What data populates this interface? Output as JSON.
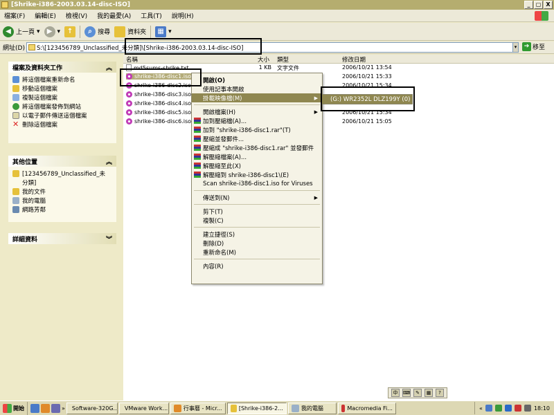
{
  "window": {
    "title": "[Shrike-i386-2003.03.14-disc-ISO]",
    "buttons": [
      "_",
      "▢",
      "X"
    ]
  },
  "menubar": {
    "items": [
      "檔案(F)",
      "編輯(E)",
      "檢視(V)",
      "我的最愛(A)",
      "工具(T)",
      "說明(H)"
    ]
  },
  "toolbar": {
    "back": "上一頁",
    "search": "搜尋",
    "folders": "資料夾"
  },
  "address": {
    "label": "網址(D)",
    "value": "S:\\[123456789_Unclassified_未分類]\\[Shrike-i386-2003.03.14-disc-ISO]",
    "go": "移至"
  },
  "left": {
    "tasks_title": "檔案及資料夾工作",
    "tasks": [
      "將這個檔案重新命名",
      "移動這個檔案",
      "複製這個檔案",
      "將這個檔案發佈到網站",
      "以電子郵件傳送這個檔案",
      "刪除這個檔案"
    ],
    "places_title": "其他位置",
    "places": [
      "[123456789_Unclassified_未",
      "分類]",
      "我的文件",
      "我的電腦",
      "網路芳鄰"
    ],
    "details_title": "詳細資料"
  },
  "columns": {
    "name": "名稱",
    "size": "大小",
    "type": "類型",
    "date": "修改日期"
  },
  "files": [
    {
      "name": "md5sums-shrike.txt",
      "size": "1 KB",
      "type": "文字文件",
      "date": "2006/10/21 13:54",
      "icon": "text-file-icon"
    },
    {
      "name": "shrike-i386-disc1.iso",
      "size": "",
      "type": "",
      "date": "2006/10/21 15:33",
      "icon": "iso-disc-icon"
    },
    {
      "name": "shrike-i386-disc2.iso",
      "size": "",
      "type": "",
      "date": "2006/10/21 15:34",
      "icon": "iso-disc-icon"
    },
    {
      "name": "shrike-i386-disc3.iso",
      "size": "",
      "type": "",
      "date": "",
      "icon": "iso-disc-icon"
    },
    {
      "name": "shrike-i386-disc4.iso",
      "size": "",
      "type": "",
      "date": "",
      "icon": "iso-disc-icon"
    },
    {
      "name": "shrike-i386-disc5.iso",
      "size": "",
      "type": "",
      "date": "2006/10/21 15:34",
      "icon": "iso-disc-icon"
    },
    {
      "name": "shrike-i386-disc6.iso",
      "size": "",
      "type": "",
      "date": "2006/10/21 15:05",
      "icon": "iso-disc-icon"
    }
  ],
  "context_menu": {
    "items": [
      {
        "label": "開啟(O)",
        "bold": true
      },
      {
        "label": "使用記事本開啟"
      },
      {
        "label": "掛載映像檔(M)",
        "highlight": true,
        "submenu": true
      },
      {
        "sep": true
      },
      {
        "label": "開啟檔案(H)",
        "submenu": true
      },
      {
        "label": "加到壓縮檔(A)...",
        "rar": true
      },
      {
        "label": "加到 \"shrike-i386-disc1.rar\"(T)",
        "rar": true
      },
      {
        "label": "壓縮並發郵件...",
        "rar": true
      },
      {
        "label": "壓縮成 \"shrike-i386-disc1.rar\" 並發郵件",
        "rar": true
      },
      {
        "label": "解壓縮檔案(A)...",
        "rar": true
      },
      {
        "label": "解壓縮至此(X)",
        "rar": true
      },
      {
        "label": "解壓縮到 shrike-i386-disc1\\(E)",
        "rar": true
      },
      {
        "label": "Scan shrike-i386-disc1.iso for Viruses"
      },
      {
        "sep": true
      },
      {
        "label": "傳送到(N)",
        "submenu": true
      },
      {
        "sep": true
      },
      {
        "label": "剪下(T)"
      },
      {
        "label": "複製(C)"
      },
      {
        "sep": true
      },
      {
        "label": "建立捷徑(S)"
      },
      {
        "label": "刪除(D)"
      },
      {
        "label": "重新命名(M)"
      },
      {
        "sep": true
      },
      {
        "label": "內容(R)"
      }
    ]
  },
  "submenu": {
    "item": "(G:) WR2352L DLZ199Y (0)"
  },
  "taskbar": {
    "start": "開始",
    "buttons": [
      "Software-320G...",
      "VMware Work...",
      "行事曆 - Micr...",
      "[Shrike-i386-2...",
      "我的電腦",
      "Macromedia Fi..."
    ],
    "active_index": 3,
    "clock": "18:10"
  },
  "colors": {
    "title_bar": "#b5ad6f",
    "selection": "#8f8750",
    "panel_bg": "#eeeac8"
  }
}
